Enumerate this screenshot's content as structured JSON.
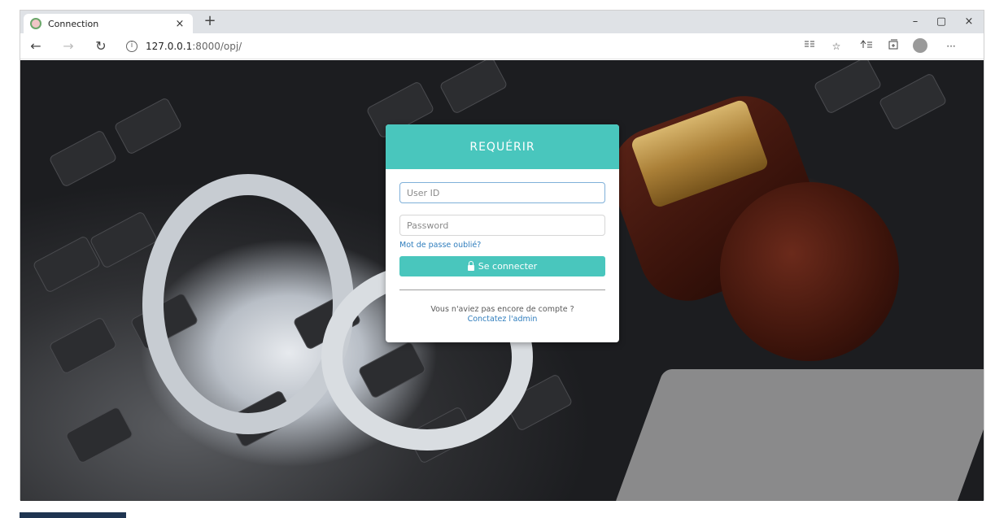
{
  "browser": {
    "tab_title": "Connection",
    "tab_close": "×",
    "new_tab": "+",
    "window": {
      "minimize": "–",
      "maximize": "▢",
      "close": "×"
    },
    "nav": {
      "back": "←",
      "forward": "→",
      "refresh": "↻"
    },
    "url": {
      "host": "127.0.0.1",
      "path": ":8000/opj/"
    },
    "toolbar_icons": [
      "reader-icon",
      "favorite-star-icon",
      "favorites-list-icon",
      "collections-icon",
      "profile-icon",
      "more-icon"
    ],
    "more_label": "···"
  },
  "login": {
    "title": "REQUÉRIR",
    "user_placeholder": "User ID",
    "password_placeholder": "Password",
    "forgot": "Mot de passe oublié?",
    "submit": "Se connecter",
    "no_account": "Vous n'aviez pas encore de compte ?",
    "contact": "Conctatez l'admin"
  },
  "colors": {
    "accent": "#49c6bd",
    "link": "#2f7dbd"
  }
}
